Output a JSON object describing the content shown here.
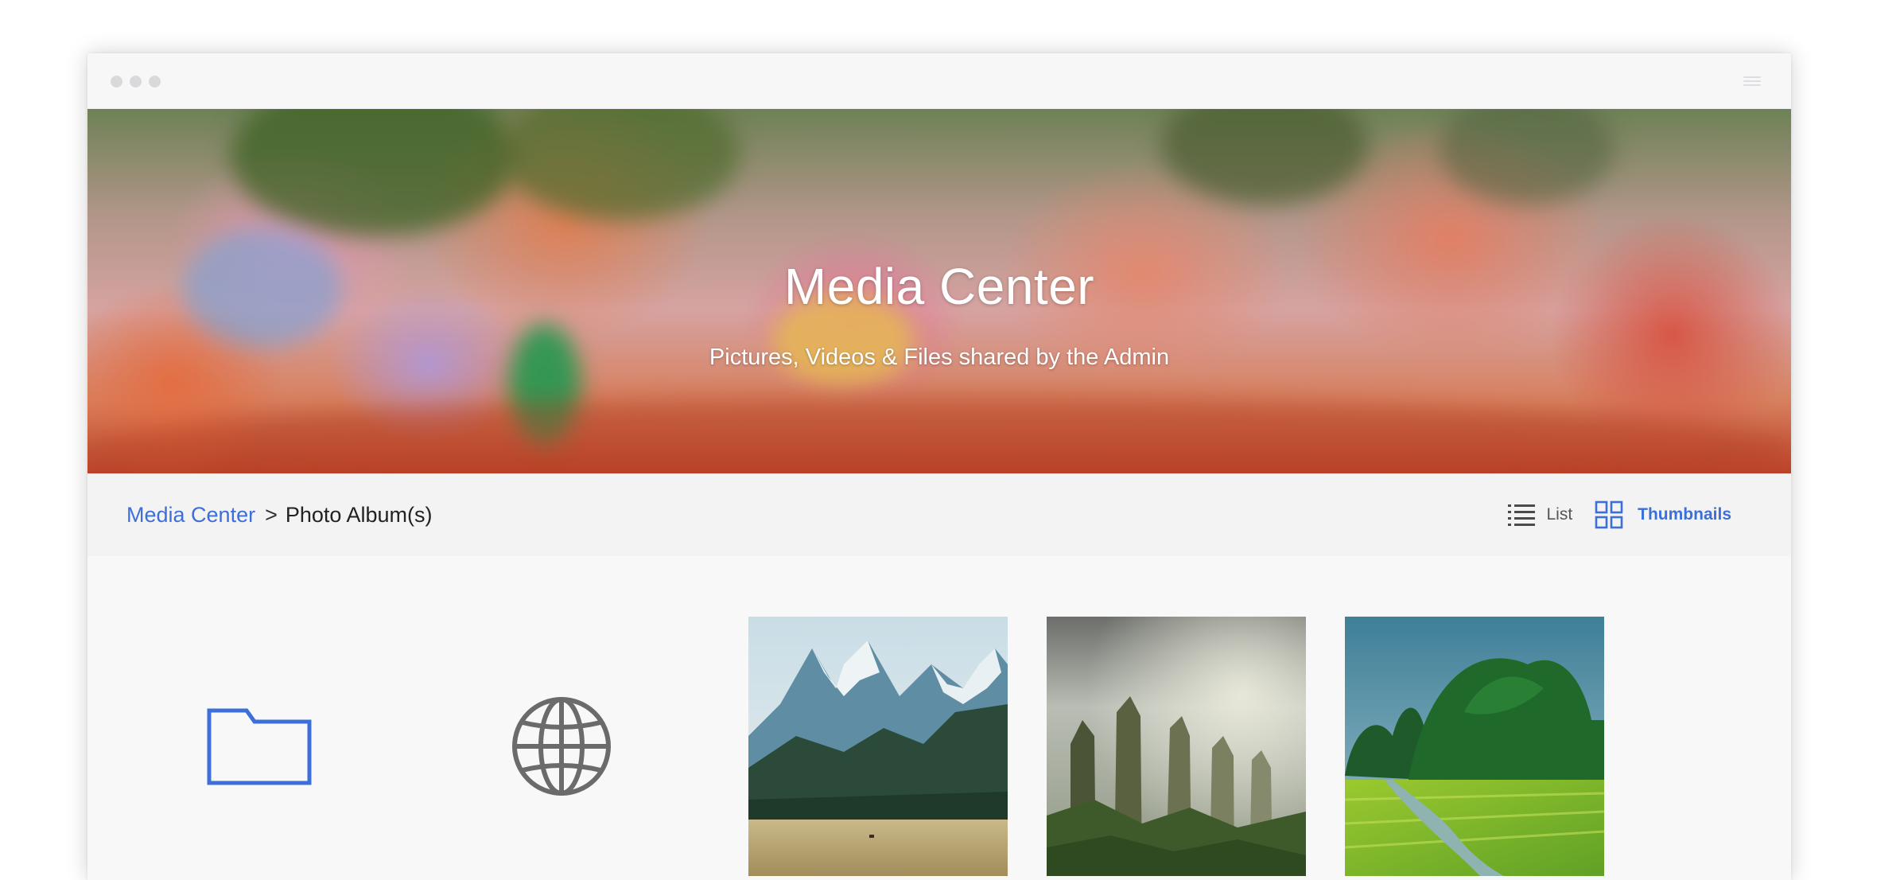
{
  "window": {
    "menu_icon": "hamburger-menu-icon"
  },
  "hero": {
    "title": "Media Center",
    "subtitle": "Pictures, Videos & Files shared by the Admin"
  },
  "breadcrumb": {
    "root": "Media Center",
    "separator": ">",
    "current": "Photo Album(s)"
  },
  "view_toggle": {
    "list_label": "List",
    "list_icon": "list-icon",
    "thumbnails_label": "Thumbnails",
    "thumbnails_icon": "grid-icon",
    "selected": "Thumbnails"
  },
  "tiles": [
    {
      "type": "icon",
      "icon": "folder-icon"
    },
    {
      "type": "icon",
      "icon": "globe-icon"
    },
    {
      "type": "photo",
      "subject": "mountains"
    },
    {
      "type": "photo",
      "subject": "rock-pillars"
    },
    {
      "type": "photo",
      "subject": "green-valley"
    }
  ],
  "colors": {
    "accent": "#3d6fd8",
    "globe": "#6b6b6b",
    "toolbar_bg": "#f3f3f4",
    "content_bg": "#f8f8f9"
  }
}
